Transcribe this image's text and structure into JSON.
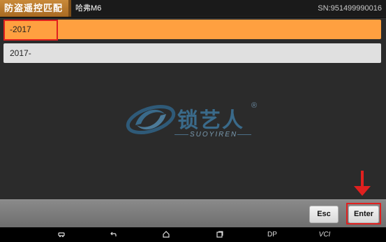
{
  "header": {
    "tab_title": "防盗遥控匹配",
    "model": "哈弗M6",
    "serial": "SN:951499990016"
  },
  "list": {
    "items": [
      {
        "label": "-2017",
        "selected": true
      },
      {
        "label": "2017-",
        "selected": false
      }
    ]
  },
  "watermark": {
    "brand": "锁艺人",
    "registered": "®",
    "subtitle": "SUOYIREN"
  },
  "actions": {
    "esc_label": "Esc",
    "enter_label": "Enter"
  },
  "navbar": {
    "dp_label": "DP",
    "vci_label": "VCI"
  },
  "colors": {
    "accent": "#ffa040",
    "header_tab": "#b8782c",
    "annotation": "#e0201f"
  }
}
